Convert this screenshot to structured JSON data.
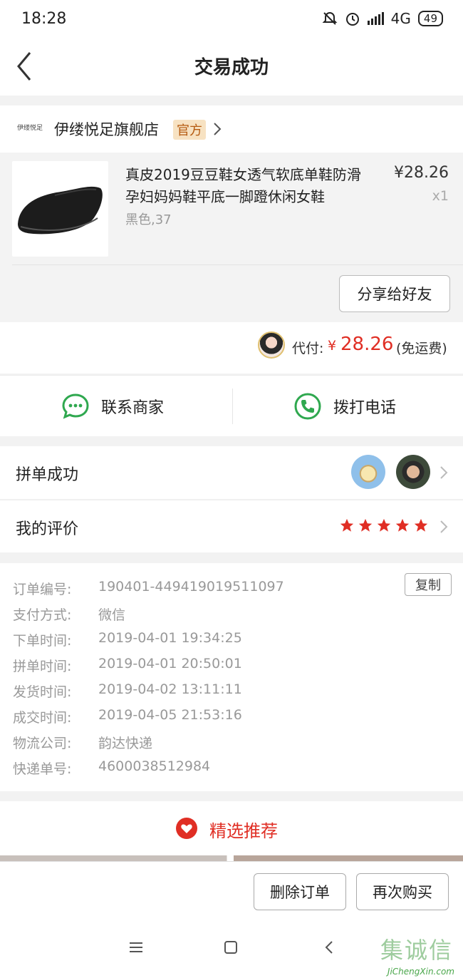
{
  "status_bar": {
    "time": "18:28",
    "network": "4G",
    "battery": "49"
  },
  "header": {
    "title": "交易成功"
  },
  "store": {
    "logo_text": "伊缕悦足",
    "name": "伊缕悦足旗舰店",
    "tag": "官方"
  },
  "product": {
    "title": "真皮2019豆豆鞋女透气软底单鞋防滑孕妇妈妈鞋平底一脚蹬休闲女鞋",
    "spec": "黑色,37",
    "price": "¥28.26",
    "quantity": "x1",
    "share_button": "分享给好友"
  },
  "payment": {
    "label": "代付:",
    "currency": "¥",
    "amount": "28.26",
    "note": "(免运费)"
  },
  "contact": {
    "merchant": "联系商家",
    "call": "拨打电话"
  },
  "group": {
    "label": "拼单成功"
  },
  "review": {
    "label": "我的评价",
    "rating": 5
  },
  "order_info": {
    "copy_button": "复制",
    "rows": [
      {
        "key": "订单编号:",
        "value": "190401-449419019511097"
      },
      {
        "key": "支付方式:",
        "value": "微信"
      },
      {
        "key": "下单时间:",
        "value": "2019-04-01 19:34:25"
      },
      {
        "key": "拼单时间:",
        "value": "2019-04-01 20:50:01"
      },
      {
        "key": "发货时间:",
        "value": "2019-04-02 13:11:11"
      },
      {
        "key": "成交时间:",
        "value": "2019-04-05 21:53:16"
      },
      {
        "key": "物流公司:",
        "value": "韵达快递"
      },
      {
        "key": "快递单号:",
        "value": "4600038512984"
      }
    ]
  },
  "recommend": {
    "title": "精选推荐"
  },
  "actions": {
    "delete": "删除订单",
    "rebuy": "再次购买"
  },
  "watermark": {
    "text": "集诚信",
    "url": "JiChengXin.com"
  },
  "colors": {
    "accent_red": "#e02e24",
    "green": "#2fa84f",
    "star": "#e02e24"
  }
}
